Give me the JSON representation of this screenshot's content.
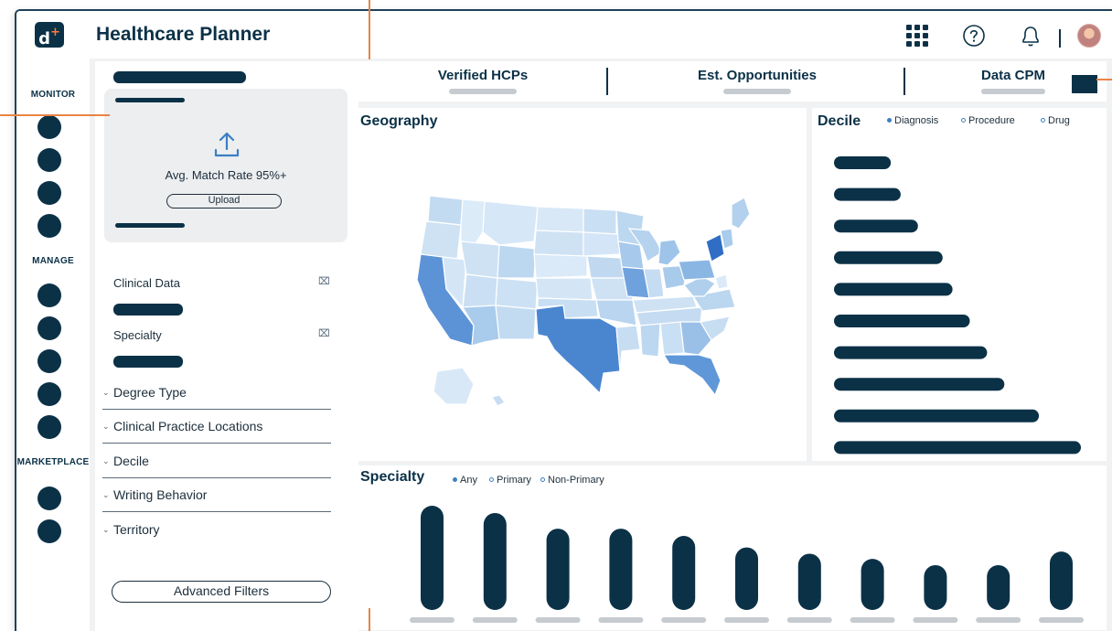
{
  "app": {
    "title": "Healthcare Planner",
    "logo_text": "d",
    "logo_plus": "+"
  },
  "topbar": {
    "icons": [
      "grid-menu-icon",
      "help-icon",
      "bell-icon",
      "avatar"
    ]
  },
  "sidebar": {
    "sections": [
      {
        "label": "MONITOR",
        "items": 4
      },
      {
        "label": "MANAGE",
        "items": 5
      },
      {
        "label": "MARKETPLACE",
        "items": 2
      }
    ]
  },
  "filters": {
    "upload": {
      "match_rate": "Avg. Match Rate 95%+",
      "button": "Upload",
      "icon": "upload-icon"
    },
    "selected": [
      {
        "label": "Clinical Data",
        "remove_icon": "close-box-icon"
      },
      {
        "label": "Specialty",
        "remove_icon": "close-box-icon"
      }
    ],
    "accordions": [
      "Degree Type",
      "Clinical Practice Locations",
      "Decile",
      "Writing Behavior",
      "Territory"
    ],
    "advanced": "Advanced Filters"
  },
  "kpis": [
    {
      "title": "Verified HCPs"
    },
    {
      "title": "Est. Opportunities"
    },
    {
      "title": "Data CPM"
    }
  ],
  "geography": {
    "title": "Geography"
  },
  "decile": {
    "title": "Decile",
    "legend": [
      "Diagnosis",
      "Procedure",
      "Drug"
    ],
    "bar_fill": [
      0.23,
      0.27,
      0.34,
      0.44,
      0.48,
      0.55,
      0.62,
      0.69,
      0.83,
      1.0
    ]
  },
  "specialty": {
    "title": "Specialty",
    "legend": [
      "Any",
      "Primary",
      "Non-Primary"
    ],
    "bar_fill": [
      1.0,
      0.93,
      0.78,
      0.78,
      0.71,
      0.6,
      0.54,
      0.49,
      0.43,
      0.43,
      0.56
    ]
  },
  "colors": {
    "navy": "#0b3147",
    "annotation": "#e98445",
    "map_dark": "#3f7fcc",
    "map_light": "#d3e6f6"
  }
}
